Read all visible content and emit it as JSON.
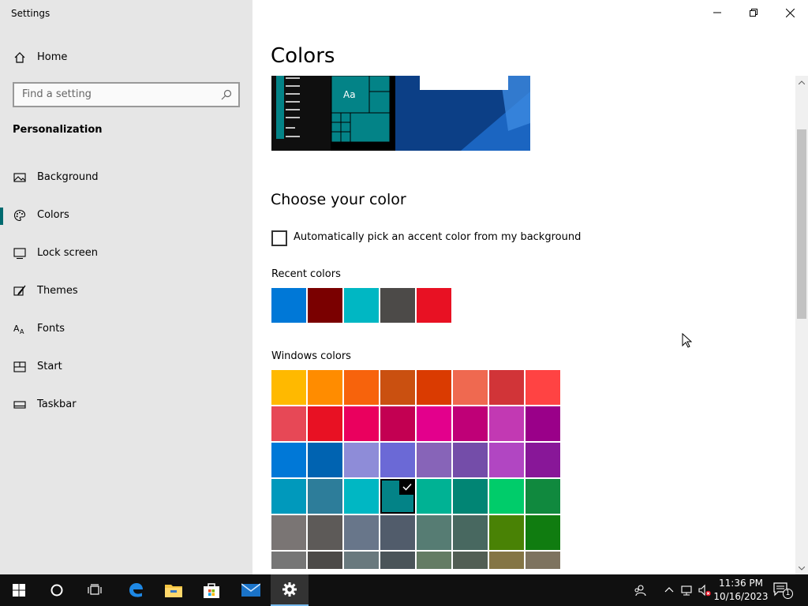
{
  "window": {
    "title": "Settings"
  },
  "sidebar": {
    "home_label": "Home",
    "search_placeholder": "Find a setting",
    "section_title": "Personalization",
    "items": [
      {
        "label": "Background",
        "icon": "picture-icon"
      },
      {
        "label": "Colors",
        "icon": "palette-icon",
        "active": true
      },
      {
        "label": "Lock screen",
        "icon": "lock-screen-icon"
      },
      {
        "label": "Themes",
        "icon": "brush-icon"
      },
      {
        "label": "Fonts",
        "icon": "font-icon"
      },
      {
        "label": "Start",
        "icon": "start-icon"
      },
      {
        "label": "Taskbar",
        "icon": "taskbar-icon"
      }
    ]
  },
  "main": {
    "title": "Colors",
    "preview_tile_text": "Aa",
    "choose_heading": "Choose your color",
    "auto_accent_label": "Automatically pick an accent color from my background",
    "auto_accent_checked": false,
    "recent_label": "Recent colors",
    "recent_colors": [
      "#0078d7",
      "#7a0000",
      "#00b7c3",
      "#4c4a48",
      "#e81123"
    ],
    "windows_label": "Windows colors",
    "windows_colors": [
      [
        "#ffb900",
        "#ff8c00",
        "#f7630c",
        "#ca5010",
        "#da3b01",
        "#ef6950",
        "#d13438",
        "#ff4343"
      ],
      [
        "#e74856",
        "#e81123",
        "#ea005e",
        "#c30052",
        "#e3008c",
        "#bf0077",
        "#c239b3",
        "#9a0089"
      ],
      [
        "#0078d7",
        "#0063b1",
        "#8e8cd8",
        "#6b69d6",
        "#8764b8",
        "#744da9",
        "#b146c2",
        "#881798"
      ],
      [
        "#0099bc",
        "#2d7d9a",
        "#00b7c3",
        "#038387",
        "#00b294",
        "#018574",
        "#00cc6a",
        "#10893e"
      ],
      [
        "#7a7574",
        "#5d5a58",
        "#68768a",
        "#515c6b",
        "#567c73",
        "#486860",
        "#498205",
        "#107c10"
      ],
      [
        "#767676",
        "#4c4a48",
        "#69797e",
        "#4a5459",
        "#647c64",
        "#525e54",
        "#847545",
        "#7e735f"
      ]
    ],
    "selected_color": "#038387"
  },
  "taskbar": {
    "time": "11:36 PM",
    "date": "10/16/2023",
    "notification_count": "1",
    "pinned": [
      "start-icon",
      "cortana-icon",
      "task-view-icon",
      "edge-icon",
      "file-explorer-icon",
      "store-icon",
      "mail-icon",
      "settings-icon"
    ]
  }
}
